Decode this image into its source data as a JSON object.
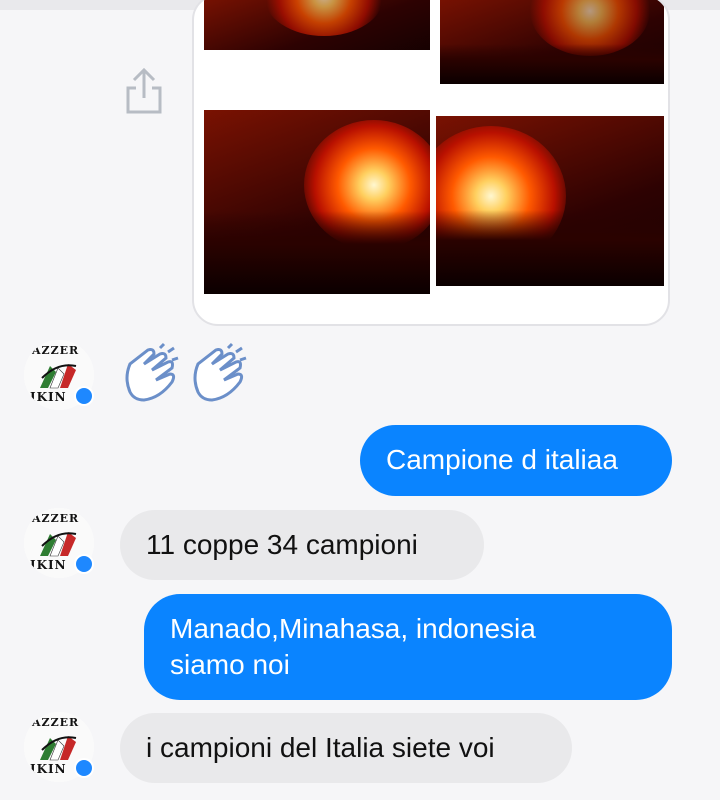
{
  "conversation": {
    "media_photos": [
      "photo-flare-1",
      "photo-flare-2",
      "photo-flare-3",
      "photo-flare-4"
    ],
    "reaction_emoji": [
      "👏",
      "👏"
    ],
    "messages": [
      {
        "side": "out",
        "text": "Campione d italiaa"
      },
      {
        "side": "in",
        "text": "11 coppe 34 campioni"
      },
      {
        "side": "out",
        "text": "Manado,Minahasa, indonesia siamo noi"
      },
      {
        "side": "in",
        "text": "i campioni del Italia siete voi"
      }
    ],
    "avatar": {
      "logo_top_text": "AZZER",
      "logo_bottom_text": "IKIN",
      "badge": "messenger-badge-icon"
    }
  },
  "colors": {
    "outgoing_bubble": "#0a84ff",
    "incoming_bubble": "#e9e9eb",
    "background": "#f6f6f8",
    "messenger_badge": "#1e88ff"
  },
  "icons": [
    "share-icon",
    "clapping-hands-icon",
    "messenger-badge-icon"
  ]
}
